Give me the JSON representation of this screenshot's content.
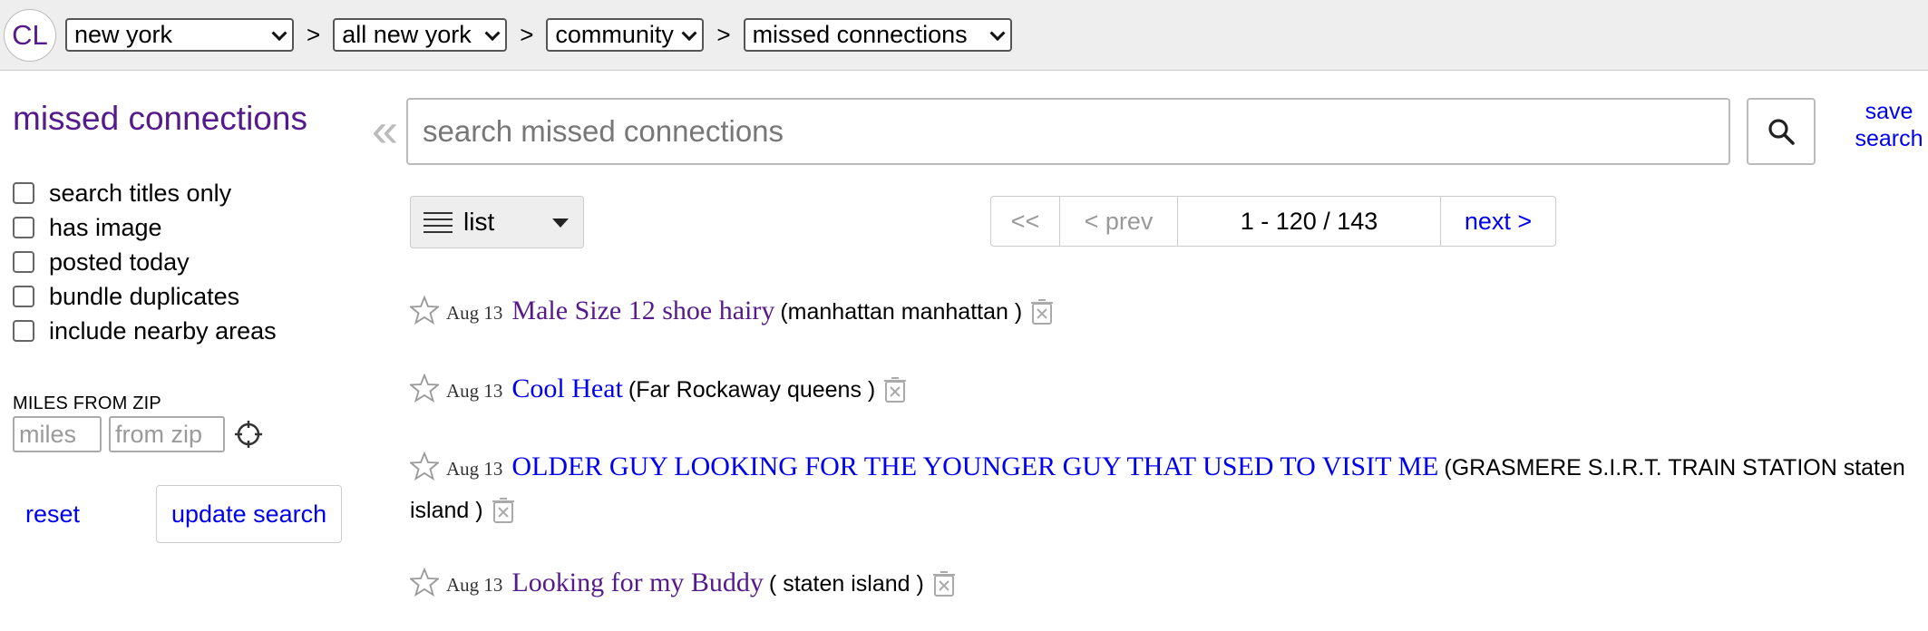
{
  "header": {
    "logo": "CL",
    "breadcrumbs": [
      {
        "value": "new york"
      },
      {
        "value": "all new york"
      },
      {
        "value": "community"
      },
      {
        "value": "missed connections"
      }
    ],
    "separator": ">"
  },
  "sidebar": {
    "title": "missed connections",
    "filters": [
      {
        "label": "search titles only",
        "checked": false
      },
      {
        "label": "has image",
        "checked": false
      },
      {
        "label": "posted today",
        "checked": false
      },
      {
        "label": "bundle duplicates",
        "checked": false
      },
      {
        "label": "include nearby areas",
        "checked": false
      }
    ],
    "miles_label": "MILES FROM ZIP",
    "miles_placeholder": "miles",
    "zip_placeholder": "from zip",
    "reset_label": "reset",
    "update_label": "update search"
  },
  "search": {
    "collapse_glyph": "«",
    "placeholder": "search missed connections",
    "save_label_line1": "save",
    "save_label_line2": "search"
  },
  "toolbar": {
    "view_label": "list",
    "pager": {
      "first": "<<",
      "prev": "< prev",
      "range": "1 - 120 / 143",
      "next": "next >"
    }
  },
  "colors": {
    "visited_link": "#551a8b",
    "link": "#0000ee",
    "topbar_bg": "#eeeeee"
  },
  "results": [
    {
      "date": "Aug 13",
      "title": "Male Size 12 shoe hairy",
      "hood": "(manhattan manhattan )",
      "visited": true
    },
    {
      "date": "Aug 13",
      "title": "Cool Heat",
      "hood": "(Far Rockaway queens )",
      "visited": false
    },
    {
      "date": "Aug 13",
      "title": "OLDER GUY LOOKING FOR THE YOUNGER GUY THAT USED TO VISIT ME",
      "hood": "(GRASMERE S.I.R.T. TRAIN STATION staten island )",
      "visited": false
    },
    {
      "date": "Aug 13",
      "title": "Looking for my Buddy",
      "hood": "( staten island )",
      "visited": true
    }
  ]
}
